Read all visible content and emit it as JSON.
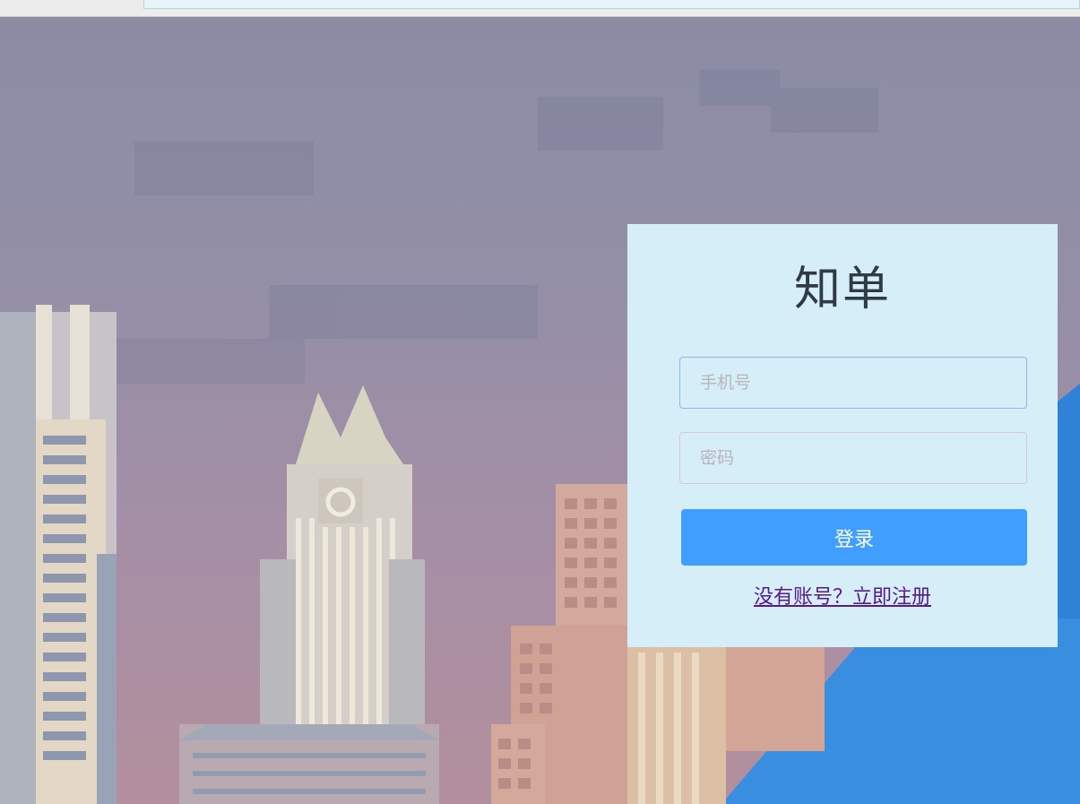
{
  "login": {
    "title": "知单",
    "phone_placeholder": "手机号",
    "password_placeholder": "密码",
    "login_label": "登录",
    "register_link": "没有账号？立即注册"
  },
  "colors": {
    "primary": "#409eff",
    "card_bg": "#d6eef7",
    "link": "#551a8b"
  }
}
